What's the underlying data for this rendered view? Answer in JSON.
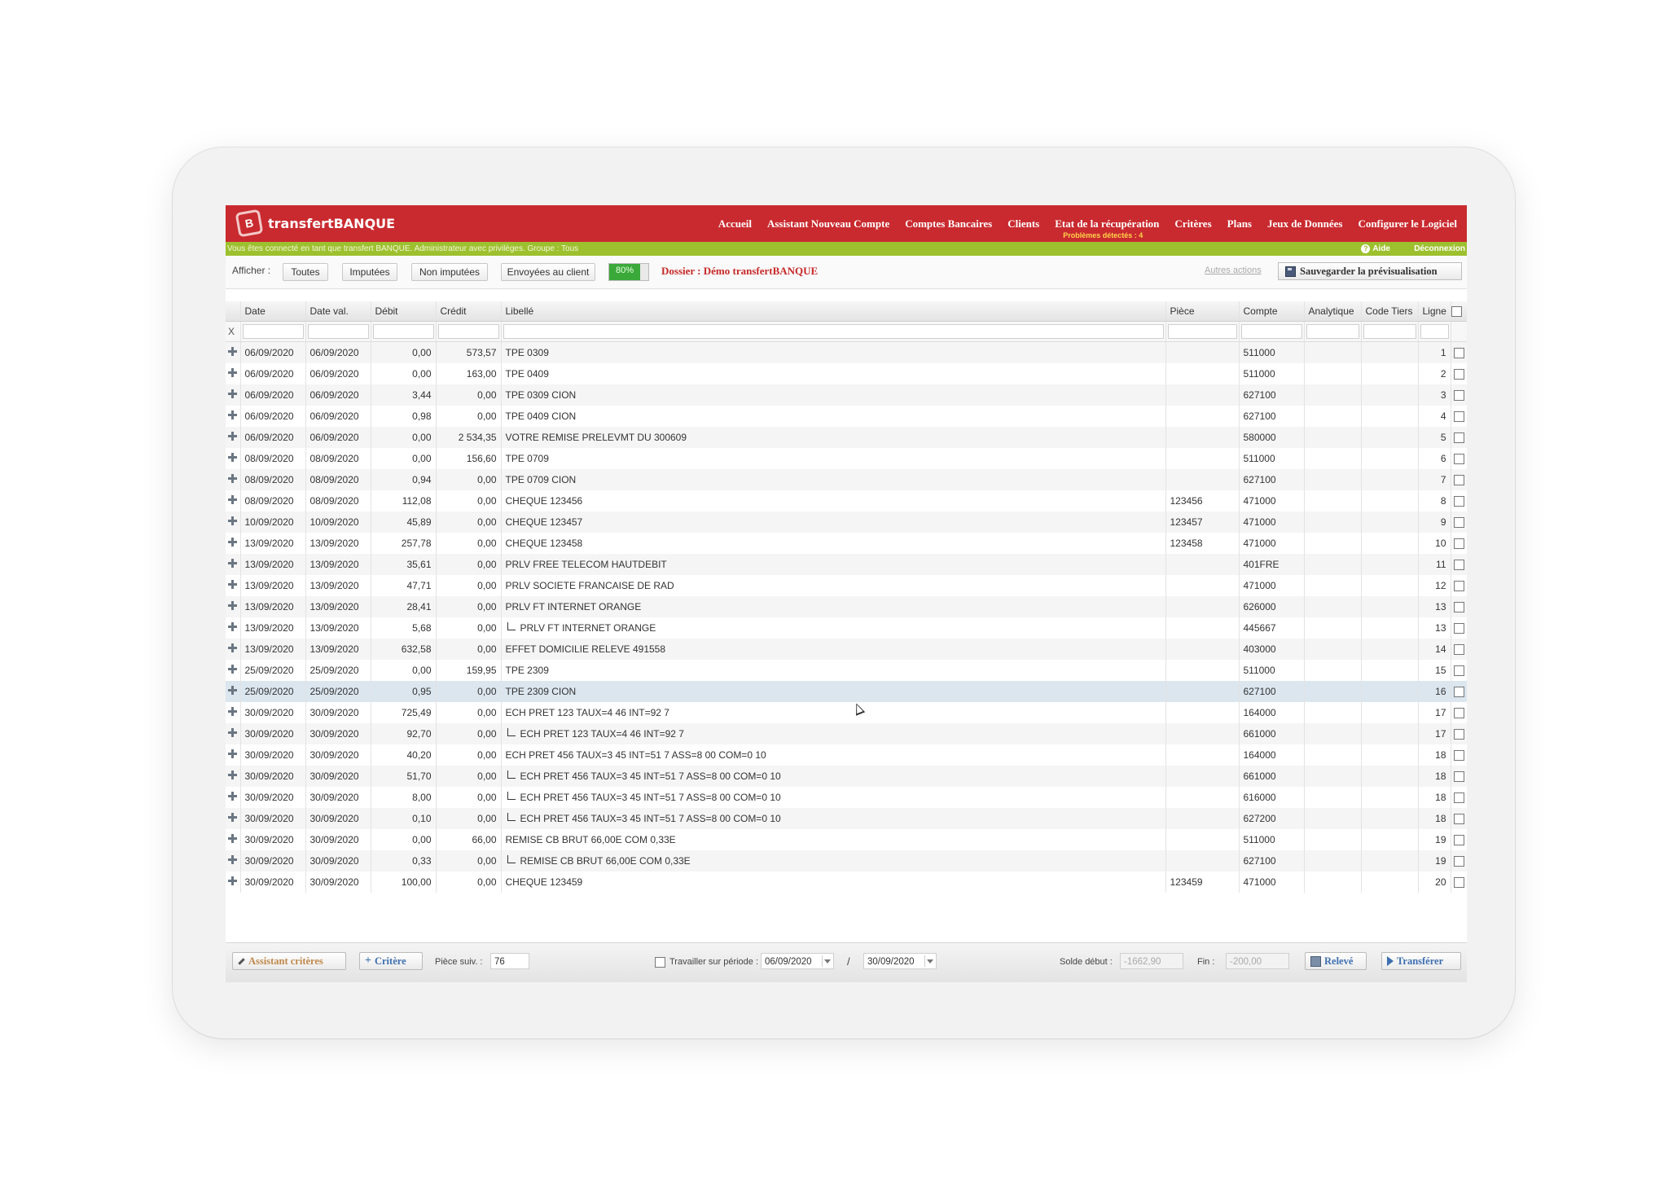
{
  "header": {
    "logo_glyph": "B",
    "app_name": "transfertBANQUE",
    "nav": [
      {
        "label": "Accueil"
      },
      {
        "label": "Assistant Nouveau Compte"
      },
      {
        "label": "Comptes Bancaires"
      },
      {
        "label": "Clients"
      },
      {
        "label": "Etat de la récupération",
        "sub": "Problèmes détectés : 4"
      },
      {
        "label": "Critères"
      },
      {
        "label": "Plans"
      },
      {
        "label": "Jeux de Données"
      },
      {
        "label": "Configurer le Logiciel"
      }
    ]
  },
  "infobar": {
    "message": "Vous êtes connecté en tant que transfert BANQUE. Administrateur avec privilèges. Groupe : Tous",
    "help_glyph": "?",
    "help": "Aide",
    "logout": "Déconnexion"
  },
  "toolbar": {
    "afficher_label": "Afficher :",
    "filters": [
      "Toutes",
      "Imputées",
      "Non imputées",
      "Envoyées au client"
    ],
    "progress_text": "80%",
    "progress_value": 0.8,
    "dossier": "Dossier : Démo transfertBANQUE",
    "autres_actions": "Autres actions",
    "save_label": "Sauvegarder la prévisualisation"
  },
  "grid": {
    "filter_marker": "X",
    "columns": [
      "Date",
      "Date val.",
      "Débit",
      "Crédit",
      "Libellé",
      "Pièce",
      "Compte",
      "Analytique",
      "Code Tiers",
      "Ligne"
    ],
    "rows": [
      {
        "date": "06/09/2020",
        "date_val": "06/09/2020",
        "debit": "0,00",
        "credit": "573,57",
        "libelle": "TPE 0309",
        "piece": "",
        "compte": "511000",
        "analytique": "",
        "code_tiers": "",
        "ligne": "1",
        "child": false
      },
      {
        "date": "06/09/2020",
        "date_val": "06/09/2020",
        "debit": "0,00",
        "credit": "163,00",
        "libelle": "TPE 0409",
        "piece": "",
        "compte": "511000",
        "analytique": "",
        "code_tiers": "",
        "ligne": "2",
        "child": false
      },
      {
        "date": "06/09/2020",
        "date_val": "06/09/2020",
        "debit": "3,44",
        "credit": "0,00",
        "libelle": "TPE 0309 CION",
        "piece": "",
        "compte": "627100",
        "analytique": "",
        "code_tiers": "",
        "ligne": "3",
        "child": false
      },
      {
        "date": "06/09/2020",
        "date_val": "06/09/2020",
        "debit": "0,98",
        "credit": "0,00",
        "libelle": "TPE 0409 CION",
        "piece": "",
        "compte": "627100",
        "analytique": "",
        "code_tiers": "",
        "ligne": "4",
        "child": false
      },
      {
        "date": "06/09/2020",
        "date_val": "06/09/2020",
        "debit": "0,00",
        "credit": "2 534,35",
        "libelle": "VOTRE REMISE PRELEVMT DU 300609",
        "piece": "",
        "compte": "580000",
        "analytique": "",
        "code_tiers": "",
        "ligne": "5",
        "child": false
      },
      {
        "date": "08/09/2020",
        "date_val": "08/09/2020",
        "debit": "0,00",
        "credit": "156,60",
        "libelle": "TPE 0709",
        "piece": "",
        "compte": "511000",
        "analytique": "",
        "code_tiers": "",
        "ligne": "6",
        "child": false
      },
      {
        "date": "08/09/2020",
        "date_val": "08/09/2020",
        "debit": "0,94",
        "credit": "0,00",
        "libelle": "TPE 0709 CION",
        "piece": "",
        "compte": "627100",
        "analytique": "",
        "code_tiers": "",
        "ligne": "7",
        "child": false
      },
      {
        "date": "08/09/2020",
        "date_val": "08/09/2020",
        "debit": "112,08",
        "credit": "0,00",
        "libelle": "CHEQUE 123456",
        "piece": "123456",
        "compte": "471000",
        "analytique": "",
        "code_tiers": "",
        "ligne": "8",
        "child": false
      },
      {
        "date": "10/09/2020",
        "date_val": "10/09/2020",
        "debit": "45,89",
        "credit": "0,00",
        "libelle": "CHEQUE 123457",
        "piece": "123457",
        "compte": "471000",
        "analytique": "",
        "code_tiers": "",
        "ligne": "9",
        "child": false
      },
      {
        "date": "13/09/2020",
        "date_val": "13/09/2020",
        "debit": "257,78",
        "credit": "0,00",
        "libelle": "CHEQUE 123458",
        "piece": "123458",
        "compte": "471000",
        "analytique": "",
        "code_tiers": "",
        "ligne": "10",
        "child": false
      },
      {
        "date": "13/09/2020",
        "date_val": "13/09/2020",
        "debit": "35,61",
        "credit": "0,00",
        "libelle": "PRLV FREE TELECOM HAUTDEBIT",
        "piece": "",
        "compte": "401FRE",
        "analytique": "",
        "code_tiers": "",
        "ligne": "11",
        "child": false
      },
      {
        "date": "13/09/2020",
        "date_val": "13/09/2020",
        "debit": "47,71",
        "credit": "0,00",
        "libelle": "PRLV SOCIETE FRANCAISE DE RAD",
        "piece": "",
        "compte": "471000",
        "analytique": "",
        "code_tiers": "",
        "ligne": "12",
        "child": false
      },
      {
        "date": "13/09/2020",
        "date_val": "13/09/2020",
        "debit": "28,41",
        "credit": "0,00",
        "libelle": "PRLV FT INTERNET ORANGE",
        "piece": "",
        "compte": "626000",
        "analytique": "",
        "code_tiers": "",
        "ligne": "13",
        "child": false
      },
      {
        "date": "13/09/2020",
        "date_val": "13/09/2020",
        "debit": "5,68",
        "credit": "0,00",
        "libelle": "PRLV FT INTERNET ORANGE",
        "piece": "",
        "compte": "445667",
        "analytique": "",
        "code_tiers": "",
        "ligne": "13",
        "child": true
      },
      {
        "date": "13/09/2020",
        "date_val": "13/09/2020",
        "debit": "632,58",
        "credit": "0,00",
        "libelle": "EFFET DOMICILIE RELEVE 491558",
        "piece": "",
        "compte": "403000",
        "analytique": "",
        "code_tiers": "",
        "ligne": "14",
        "child": false
      },
      {
        "date": "25/09/2020",
        "date_val": "25/09/2020",
        "debit": "0,00",
        "credit": "159,95",
        "libelle": "TPE 2309",
        "piece": "",
        "compte": "511000",
        "analytique": "",
        "code_tiers": "",
        "ligne": "15",
        "child": false
      },
      {
        "date": "25/09/2020",
        "date_val": "25/09/2020",
        "debit": "0,95",
        "credit": "0,00",
        "libelle": "TPE 2309 CION",
        "piece": "",
        "compte": "627100",
        "analytique": "",
        "code_tiers": "",
        "ligne": "16",
        "child": false,
        "selected": true
      },
      {
        "date": "30/09/2020",
        "date_val": "30/09/2020",
        "debit": "725,49",
        "credit": "0,00",
        "libelle": "ECH PRET 123 TAUX=4 46 INT=92 7",
        "piece": "",
        "compte": "164000",
        "analytique": "",
        "code_tiers": "",
        "ligne": "17",
        "child": false
      },
      {
        "date": "30/09/2020",
        "date_val": "30/09/2020",
        "debit": "92,70",
        "credit": "0,00",
        "libelle": "ECH PRET 123 TAUX=4 46 INT=92 7",
        "piece": "",
        "compte": "661000",
        "analytique": "",
        "code_tiers": "",
        "ligne": "17",
        "child": true
      },
      {
        "date": "30/09/2020",
        "date_val": "30/09/2020",
        "debit": "40,20",
        "credit": "0,00",
        "libelle": "ECH PRET 456 TAUX=3 45 INT=51 7 ASS=8 00 COM=0 10",
        "piece": "",
        "compte": "164000",
        "analytique": "",
        "code_tiers": "",
        "ligne": "18",
        "child": false
      },
      {
        "date": "30/09/2020",
        "date_val": "30/09/2020",
        "debit": "51,70",
        "credit": "0,00",
        "libelle": "ECH PRET 456 TAUX=3 45 INT=51 7 ASS=8 00 COM=0 10",
        "piece": "",
        "compte": "661000",
        "analytique": "",
        "code_tiers": "",
        "ligne": "18",
        "child": true
      },
      {
        "date": "30/09/2020",
        "date_val": "30/09/2020",
        "debit": "8,00",
        "credit": "0,00",
        "libelle": "ECH PRET 456 TAUX=3 45 INT=51 7 ASS=8 00 COM=0 10",
        "piece": "",
        "compte": "616000",
        "analytique": "",
        "code_tiers": "",
        "ligne": "18",
        "child": true
      },
      {
        "date": "30/09/2020",
        "date_val": "30/09/2020",
        "debit": "0,10",
        "credit": "0,00",
        "libelle": "ECH PRET 456 TAUX=3 45 INT=51 7 ASS=8 00 COM=0 10",
        "piece": "",
        "compte": "627200",
        "analytique": "",
        "code_tiers": "",
        "ligne": "18",
        "child": true
      },
      {
        "date": "30/09/2020",
        "date_val": "30/09/2020",
        "debit": "0,00",
        "credit": "66,00",
        "libelle": "REMISE CB BRUT 66,00E COM 0,33E",
        "piece": "",
        "compte": "511000",
        "analytique": "",
        "code_tiers": "",
        "ligne": "19",
        "child": false
      },
      {
        "date": "30/09/2020",
        "date_val": "30/09/2020",
        "debit": "0,33",
        "credit": "0,00",
        "libelle": "REMISE CB BRUT 66,00E COM 0,33E",
        "piece": "",
        "compte": "627100",
        "analytique": "",
        "code_tiers": "",
        "ligne": "19",
        "child": true
      },
      {
        "date": "30/09/2020",
        "date_val": "30/09/2020",
        "debit": "100,00",
        "credit": "0,00",
        "libelle": "CHEQUE 123459",
        "piece": "123459",
        "compte": "471000",
        "analytique": "",
        "code_tiers": "",
        "ligne": "20",
        "child": false
      }
    ]
  },
  "footer": {
    "assistant_criteres": "Assistant critères",
    "critere": "Critère",
    "piece_suiv_label": "Pièce suiv. :",
    "piece_suiv_value": "76",
    "travailler_label": "Travailler sur période :",
    "date_start": "06/09/2020",
    "separator": "/",
    "date_end": "30/09/2020",
    "solde_debut_label": "Solde début :",
    "solde_debut_value": "-1662,90",
    "fin_label": "Fin :",
    "fin_value": "-200,00",
    "releve": "Relevé",
    "transferer": "Transférer"
  }
}
